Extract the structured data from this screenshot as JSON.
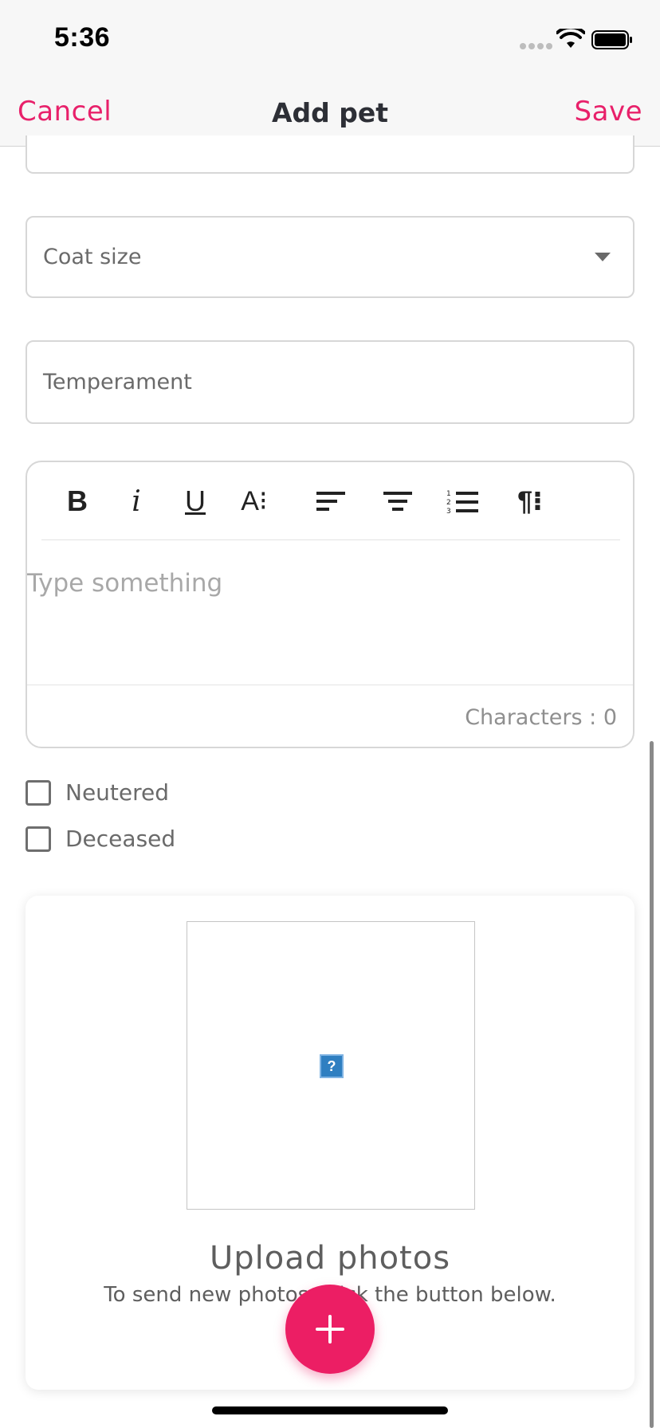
{
  "status_bar": {
    "time": "5:36"
  },
  "nav": {
    "cancel_label": "Cancel",
    "title": "Add pet",
    "save_label": "Save"
  },
  "form": {
    "coat_size": {
      "placeholder": "Coat size",
      "icon": "chevron-down-icon"
    },
    "temperament": {
      "placeholder": "Temperament"
    }
  },
  "editor": {
    "toolbar": [
      {
        "name": "bold-icon",
        "label": "B"
      },
      {
        "name": "italic-icon",
        "label": "i"
      },
      {
        "name": "underline-icon",
        "label": "U"
      },
      {
        "name": "text-size-icon",
        "label": "A⁝"
      },
      {
        "name": "align-left-icon",
        "label": ""
      },
      {
        "name": "align-center-icon",
        "label": ""
      },
      {
        "name": "numbered-list-icon",
        "label": ""
      },
      {
        "name": "paragraph-icon",
        "label": "¶⁝"
      }
    ],
    "placeholder": "Type something",
    "char_count": "Characters : 0"
  },
  "checkboxes": {
    "neutered": {
      "label": "Neutered",
      "checked": false
    },
    "deceased": {
      "label": "Deceased",
      "checked": false
    }
  },
  "photos": {
    "broken_glyph": "?",
    "title": "Upload photos",
    "subtitle": "To send new photos, click the button below."
  },
  "colors": {
    "accent": "#e8206a",
    "fab": "#ec1e64",
    "border": "#d7d7d7",
    "text_muted": "#6a6a6a"
  }
}
